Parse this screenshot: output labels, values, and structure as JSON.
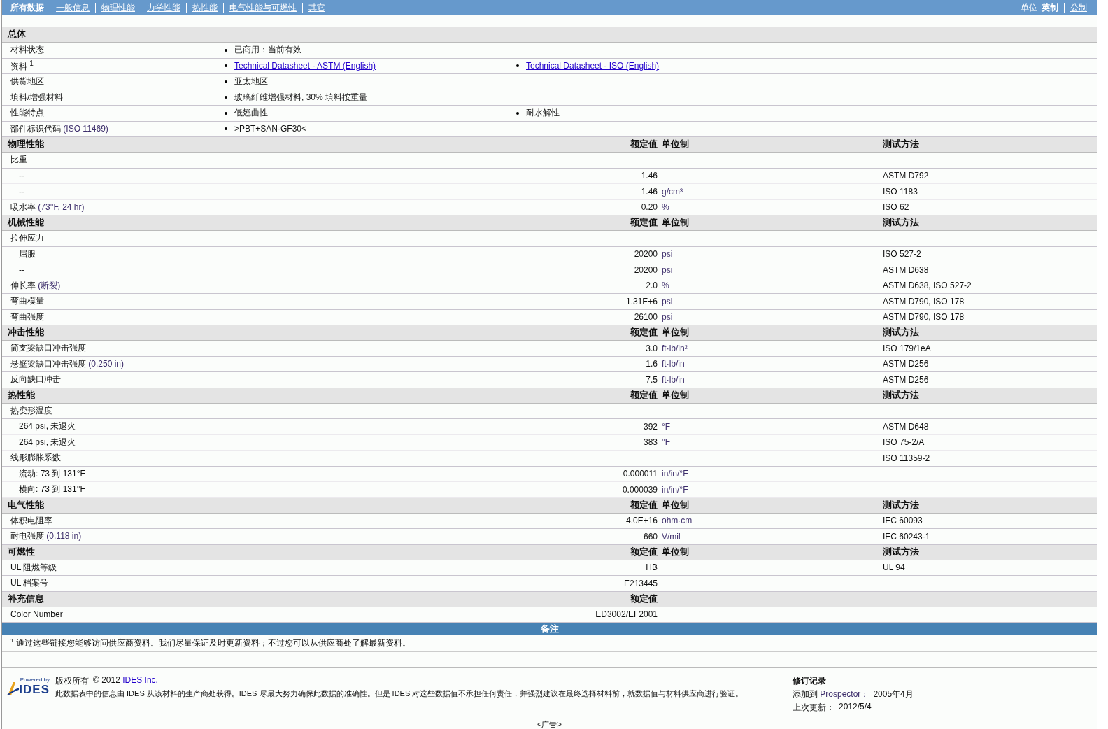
{
  "nav": {
    "tabs": [
      {
        "label": "所有数据",
        "selected": true
      },
      {
        "label": "一般信息",
        "selected": false
      },
      {
        "label": "物理性能",
        "selected": false
      },
      {
        "label": "力学性能",
        "selected": false
      },
      {
        "label": "热性能",
        "selected": false
      },
      {
        "label": "电气性能与可燃性",
        "selected": false
      },
      {
        "label": "其它",
        "selected": false
      }
    ],
    "units_label": "单位",
    "units": [
      {
        "label": "英制",
        "selected": true
      },
      {
        "label": "公制",
        "selected": false
      }
    ]
  },
  "sections": [
    {
      "kind": "general",
      "title": "总体",
      "rows": [
        {
          "label": "材料状态",
          "items": [
            {
              "text": "已商用：当前有效",
              "link": false
            }
          ]
        },
        {
          "label": "资料 $^{1}$",
          "items": [
            {
              "text": "Technical Datasheet - ASTM (English)",
              "link": true
            },
            {
              "text": "Technical Datasheet - ISO (English)",
              "link": true
            }
          ]
        },
        {
          "label": "供货地区",
          "items": [
            {
              "text": "亚太地区",
              "link": false
            }
          ]
        },
        {
          "label": "填料/增强材料",
          "items": [
            {
              "text": "玻璃纤维增强材料, 30% 填料按重量",
              "link": false
            }
          ]
        },
        {
          "label": "性能特点",
          "items": [
            {
              "text": "低翘曲性",
              "link": false
            },
            {
              "text": "耐水解性",
              "link": false
            }
          ]
        },
        {
          "label": "部件标识代码",
          "note": "(ISO 11469)",
          "items": [
            {
              "text": ">PBT+SAN-GF30<",
              "link": false
            }
          ]
        }
      ]
    },
    {
      "kind": "properties",
      "title": "物理性能",
      "columns": {
        "value": "额定值",
        "unit": "单位制",
        "method": "测试方法"
      },
      "rows": [
        {
          "label": "比重",
          "children": [
            {
              "label": "--",
              "value": "1.46",
              "method": "ASTM D792"
            },
            {
              "label": "--",
              "value": "1.46",
              "unit": "g/cm³",
              "method": "ISO 1183"
            }
          ]
        },
        {
          "label": "吸水率",
          "note": "(73°F, 24 hr)",
          "value": "0.20",
          "unit": "%",
          "method": "ISO 62"
        }
      ]
    },
    {
      "kind": "properties",
      "title": "机械性能",
      "columns": {
        "value": "额定值",
        "unit": "单位制",
        "method": "测试方法"
      },
      "rows": [
        {
          "label": "拉伸应力",
          "children": [
            {
              "label": "屈服",
              "value": "20200",
              "unit": "psi",
              "method": "ISO 527-2"
            },
            {
              "label": "--",
              "value": "20200",
              "unit": "psi",
              "method": "ASTM D638"
            }
          ]
        },
        {
          "label": "伸长率",
          "note": "(断裂)",
          "value": "2.0",
          "unit": "%",
          "method": "ASTM D638, ISO 527-2"
        },
        {
          "label": "弯曲模量",
          "value": "1.31E+6",
          "unit": "psi",
          "method": "ASTM D790, ISO 178"
        },
        {
          "label": "弯曲强度",
          "value": "26100",
          "unit": "psi",
          "method": "ASTM D790, ISO 178"
        }
      ]
    },
    {
      "kind": "properties",
      "title": "冲击性能",
      "columns": {
        "value": "额定值",
        "unit": "单位制",
        "method": "测试方法"
      },
      "rows": [
        {
          "label": "简支梁缺口冲击强度",
          "value": "3.0",
          "unit": "ft·lb/in²",
          "method": "ISO 179/1eA"
        },
        {
          "label": "悬壁梁缺口冲击强度",
          "note": "(0.250 in)",
          "value": "1.6",
          "unit": "ft·lb/in",
          "method": "ASTM D256"
        },
        {
          "label": "反向缺口冲击",
          "value": "7.5",
          "unit": "ft·lb/in",
          "method": "ASTM D256"
        }
      ]
    },
    {
      "kind": "properties",
      "title": "热性能",
      "columns": {
        "value": "额定值",
        "unit": "单位制",
        "method": "测试方法"
      },
      "rows": [
        {
          "label": "热变形温度",
          "children": [
            {
              "label": "264 psi, 未退火",
              "value": "392",
              "unit": "°F",
              "method": "ASTM D648"
            },
            {
              "label": "264 psi, 未退火",
              "value": "383",
              "unit": "°F",
              "method": "ISO 75-2/A"
            }
          ]
        },
        {
          "label": "线形膨胀系数",
          "method": "ISO 11359-2",
          "children": [
            {
              "label": "流动: 73 到  131°F",
              "value": "0.000011",
              "unit": "in/in/°F"
            },
            {
              "label": "横向: 73 到  131°F",
              "value": "0.000039",
              "unit": "in/in/°F"
            }
          ]
        }
      ]
    },
    {
      "kind": "properties",
      "title": "电气性能",
      "columns": {
        "value": "额定值",
        "unit": "单位制",
        "method": "测试方法"
      },
      "rows": [
        {
          "label": "体积电阻率",
          "value": "4.0E+16",
          "unit": "ohm·cm",
          "method": "IEC 60093"
        },
        {
          "label": "耐电强度",
          "note": "(0.118 in)",
          "value": "660",
          "unit": "V/mil",
          "method": "IEC 60243-1"
        }
      ]
    },
    {
      "kind": "properties",
      "title": "可燃性",
      "columns": {
        "value": "额定值",
        "unit": "单位制",
        "method": "测试方法"
      },
      "rows": [
        {
          "label": "UL 阻燃等级",
          "value": "HB",
          "method": "UL 94"
        },
        {
          "label": "UL 档案号",
          "value": "E213445"
        }
      ]
    },
    {
      "kind": "properties",
      "title": "补充信息",
      "columns": {
        "value": "额定值"
      },
      "rows": [
        {
          "label": "Color Number",
          "value": "ED3002/EF2001"
        }
      ]
    }
  ],
  "remarks": {
    "title": "备注",
    "notes": [
      {
        "mark": "1",
        "text": "通过这些链接您能够访问供应商资料。我们尽量保证及时更新资料；不过您可以从供应商处了解最新资料。"
      }
    ]
  },
  "footer": {
    "logo": {
      "tagline": "Powered by",
      "name": "IDES"
    },
    "copyright": "版权所有",
    "year": "© 2012",
    "company": "IDES Inc.",
    "disclaimer": "此数据表中的信息由 IDES 从该材料的生产商处获得。IDES 尽最大努力确保此数据的准确性。但是 IDES 对这些数据值不承担任何责任，并强烈建议在最终选择材料前，就数据值与材料供应商进行验证。",
    "revision": {
      "title": "修订记录",
      "lines": [
        {
          "label": "添加到",
          "term": "Prospector：",
          "value": "2005年4月"
        },
        {
          "label": "上次更新：",
          "value": "2012/5/4"
        }
      ]
    }
  },
  "ad": "<广告>"
}
